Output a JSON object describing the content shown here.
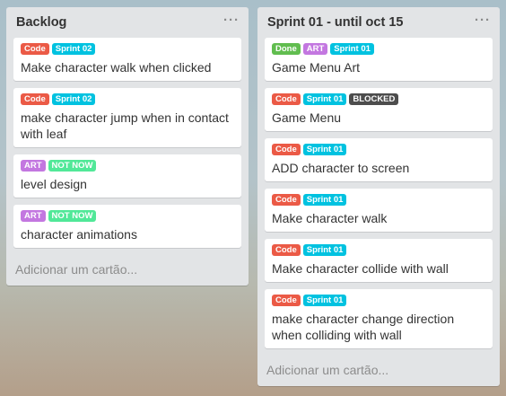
{
  "colors": {
    "Code": "#eb5a46",
    "Sprint 02": "#00c2e0",
    "Sprint 01": "#00c2e0",
    "ART": "#c377e0",
    "NOT NOW": "#51e898",
    "Done": "#61bd4f",
    "BLOCKED": "#4d4d4d"
  },
  "lists": [
    {
      "title": "Backlog",
      "menu": "···",
      "add_card": "Adicionar um cartão...",
      "cards": [
        {
          "labels": [
            "Code",
            "Sprint 02"
          ],
          "title": "Make character walk when clicked"
        },
        {
          "labels": [
            "Code",
            "Sprint 02"
          ],
          "title": "make character jump when in contact with leaf"
        },
        {
          "labels": [
            "ART",
            "NOT NOW"
          ],
          "title": "level design"
        },
        {
          "labels": [
            "ART",
            "NOT NOW"
          ],
          "title": "character animations"
        }
      ]
    },
    {
      "title": "Sprint 01 - until oct 15",
      "menu": "···",
      "add_card": "Adicionar um cartão...",
      "cards": [
        {
          "labels": [
            "Done",
            "ART",
            "Sprint 01"
          ],
          "title": "Game Menu Art"
        },
        {
          "labels": [
            "Code",
            "Sprint 01",
            "BLOCKED"
          ],
          "title": "Game Menu"
        },
        {
          "labels": [
            "Code",
            "Sprint 01"
          ],
          "title": "ADD character to screen"
        },
        {
          "labels": [
            "Code",
            "Sprint 01"
          ],
          "title": "Make character walk"
        },
        {
          "labels": [
            "Code",
            "Sprint 01"
          ],
          "title": "Make character collide with wall"
        },
        {
          "labels": [
            "Code",
            "Sprint 01"
          ],
          "title": "make character change direction when colliding with wall"
        }
      ]
    }
  ]
}
